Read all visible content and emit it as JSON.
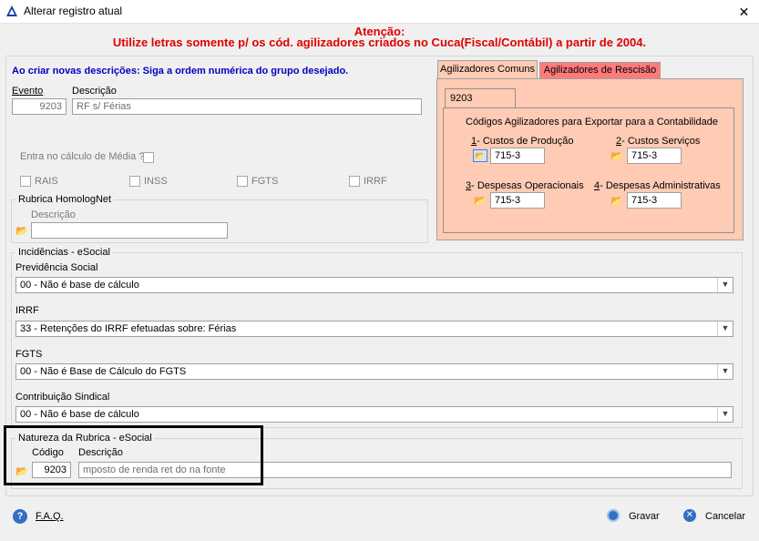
{
  "window": {
    "title": "Alterar registro atual",
    "close_glyph": "✕"
  },
  "warning": {
    "line1": "Atenção:",
    "line2": "Utilize letras somente p/ os cód. agilizadores criados no Cuca(Fiscal/Contábil) a partir de 2004."
  },
  "instructions": "Ao criar novas descrições: Siga a ordem numérica do grupo desejado.",
  "evento": {
    "label": "Evento",
    "value": "9203"
  },
  "descricao": {
    "label": "Descrição",
    "value": "RF s/ Férias"
  },
  "media": {
    "label": "Entra no cálculo de Média ?"
  },
  "checks": {
    "rais": "RAIS",
    "inss": "INSS",
    "fgts": "FGTS",
    "irrf": "IRRF"
  },
  "homolognet": {
    "title": "Rubrica HomologNet",
    "desc_label": "Descrição",
    "desc_value": ""
  },
  "tabs": {
    "comuns": "Agilizadores Comuns",
    "rescisao": "Agilizadores de Rescisão",
    "inner": "9203"
  },
  "agilizadores": {
    "heading": "Códigos Agilizadores para Exportar para a Contabilidade",
    "items": [
      {
        "num": "1",
        "label": "- Custos de Produção",
        "value": "715-3"
      },
      {
        "num": "2",
        "label": "- Custos Serviços",
        "value": "715-3"
      },
      {
        "num": "3",
        "label": "- Despesas Operacionais",
        "value": "715-3"
      },
      {
        "num": "4",
        "label": "- Despesas Administrativas",
        "value": "715-3"
      }
    ]
  },
  "esocial": {
    "title": "Incidências - eSocial",
    "fields": [
      {
        "label": "Previdência Social",
        "value": "00 - Não é base de cálculo"
      },
      {
        "label": "IRRF",
        "value": "33 - Retenções do IRRF efetuadas sobre: Férias"
      },
      {
        "label": "FGTS",
        "value": "00 - Não é Base de Cálculo do FGTS"
      },
      {
        "label": "Contribuição Sindical",
        "value": "00 - Não é base de cálculo"
      }
    ]
  },
  "natureza": {
    "title": "Natureza da Rubrica - eSocial",
    "codigo_label": "Código",
    "descricao_label": "Descrição",
    "codigo_value": "9203",
    "descricao_value": "mposto de renda ret do na fonte"
  },
  "footer": {
    "faq": "F.A.Q.",
    "gravar": "Gravar",
    "cancelar": "Cancelar"
  },
  "colors": {
    "accent_tab": "#ffcbb4",
    "rescisao_tab": "#ff7b7b",
    "warning": "#e00000",
    "blue": "#0000c0"
  }
}
